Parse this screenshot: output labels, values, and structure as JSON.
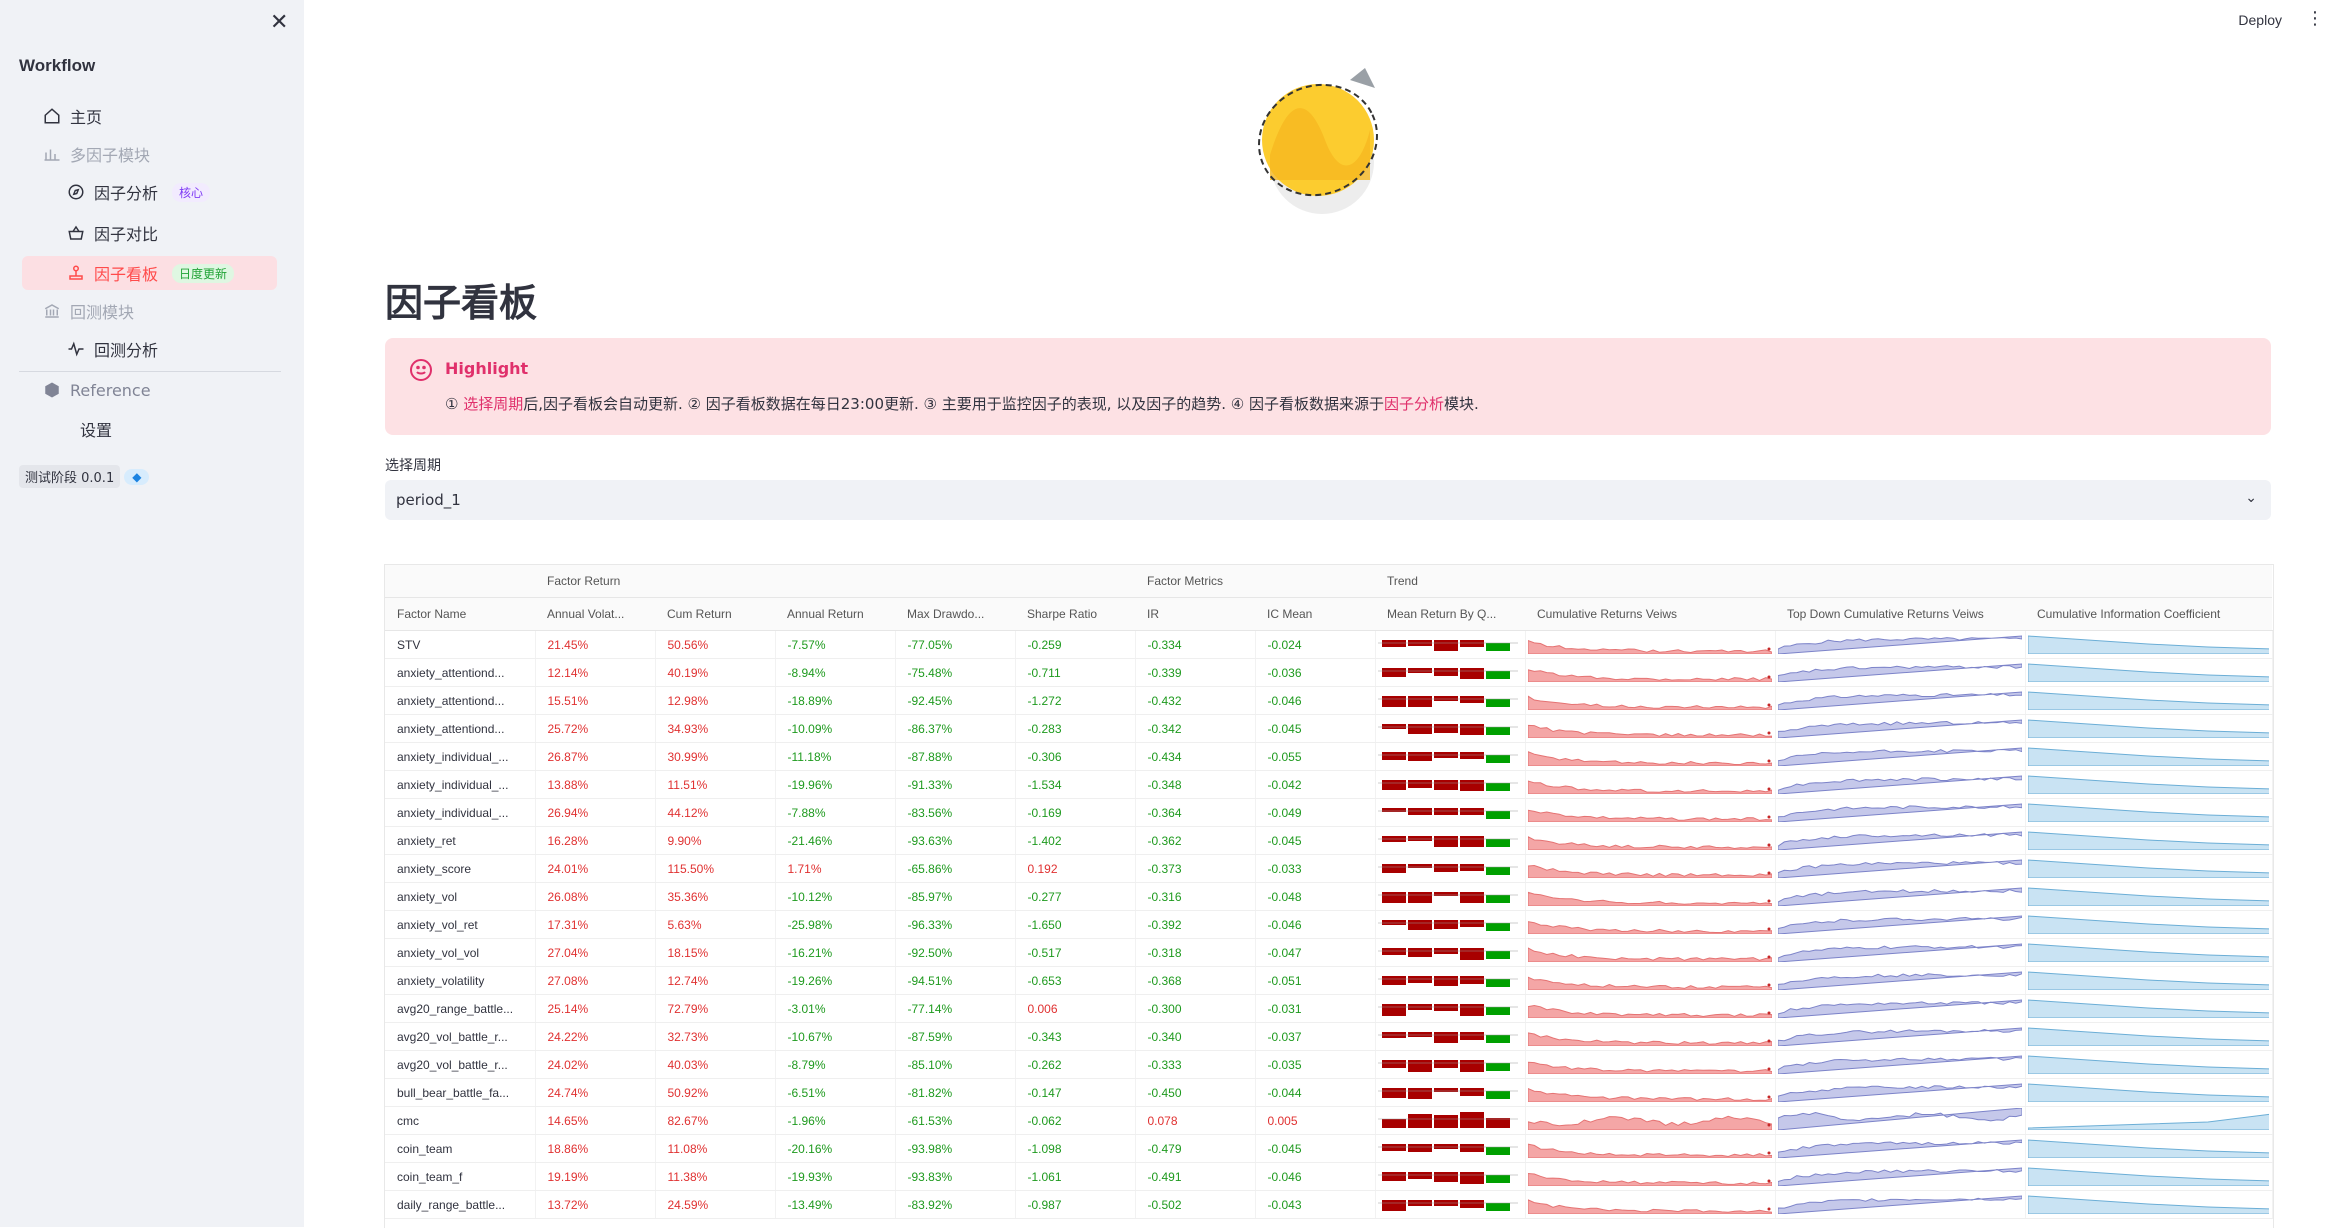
{
  "sidebar": {
    "close_icon": "close-icon",
    "title": "Workflow",
    "items": [
      {
        "label": "主页",
        "icon": "home-icon",
        "kind": "top"
      },
      {
        "label": "多因子模块",
        "icon": "bar-chart-icon",
        "kind": "section"
      },
      {
        "label": "因子分析",
        "icon": "compass-icon",
        "kind": "sub",
        "badge": "核心"
      },
      {
        "label": "因子对比",
        "icon": "basket-icon",
        "kind": "sub"
      },
      {
        "label": "因子看板",
        "icon": "joystick-icon",
        "kind": "sub-active",
        "badge": "日度更新"
      },
      {
        "label": "回测模块",
        "icon": "bank-icon",
        "kind": "section"
      },
      {
        "label": "回测分析",
        "icon": "activity-icon",
        "kind": "sub"
      },
      {
        "label": "Reference",
        "icon": "box-icon",
        "kind": "section"
      },
      {
        "label": "设置",
        "icon": "",
        "kind": "sub"
      }
    ],
    "version_label": "测试阶段 0.0.1",
    "version_icon": "cube-icon"
  },
  "header": {
    "deploy_label": "Deploy",
    "menu_icon": "more-vertical-icon"
  },
  "main": {
    "title": "因子看板",
    "alert": {
      "heading": "Highlight",
      "icon": "smile-icon",
      "p1": "① ",
      "link1": "选择周期",
      "p2": "后,因子看板会自动更新. ② 因子看板数据在每日23:00更新. ③ 主要用于监控因子的表现, 以及因子的趋势. ④ 因子看板数据来源于",
      "link2": "因子分析",
      "p3": "模块."
    },
    "select_label": "选择周期",
    "select_value": "period_1"
  },
  "table": {
    "groups": [
      "",
      "Factor Return",
      "",
      "",
      "",
      "",
      "Factor Metrics",
      "",
      "Trend",
      "",
      "",
      ""
    ],
    "headers": [
      "Factor Name",
      "Annual Volat...",
      "Cum Return",
      "Annual Return",
      "Max Drawdo...",
      "Sharpe Ratio",
      "IR",
      "IC Mean",
      "Mean Return By Q...",
      "Cumulative Returns Veiws",
      "Top Down Cumulative Returns Veiws",
      "Cumulative Information Coefficient"
    ],
    "rows": [
      [
        "STV",
        "21.45%",
        "50.56%",
        "-7.57%",
        "-77.05%",
        "-0.259",
        "-0.334",
        "-0.024"
      ],
      [
        "anxiety_attentiond...",
        "12.14%",
        "40.19%",
        "-8.94%",
        "-75.48%",
        "-0.711",
        "-0.339",
        "-0.036"
      ],
      [
        "anxiety_attentiond...",
        "15.51%",
        "12.98%",
        "-18.89%",
        "-92.45%",
        "-1.272",
        "-0.432",
        "-0.046"
      ],
      [
        "anxiety_attentiond...",
        "25.72%",
        "34.93%",
        "-10.09%",
        "-86.37%",
        "-0.283",
        "-0.342",
        "-0.045"
      ],
      [
        "anxiety_individual_...",
        "26.87%",
        "30.99%",
        "-11.18%",
        "-87.88%",
        "-0.306",
        "-0.434",
        "-0.055"
      ],
      [
        "anxiety_individual_...",
        "13.88%",
        "11.51%",
        "-19.96%",
        "-91.33%",
        "-1.534",
        "-0.348",
        "-0.042"
      ],
      [
        "anxiety_individual_...",
        "26.94%",
        "44.12%",
        "-7.88%",
        "-83.56%",
        "-0.169",
        "-0.364",
        "-0.049"
      ],
      [
        "anxiety_ret",
        "16.28%",
        "9.90%",
        "-21.46%",
        "-93.63%",
        "-1.402",
        "-0.362",
        "-0.045"
      ],
      [
        "anxiety_score",
        "24.01%",
        "115.50%",
        "1.71%",
        "-65.86%",
        "0.192",
        "-0.373",
        "-0.033"
      ],
      [
        "anxiety_vol",
        "26.08%",
        "35.36%",
        "-10.12%",
        "-85.97%",
        "-0.277",
        "-0.316",
        "-0.048"
      ],
      [
        "anxiety_vol_ret",
        "17.31%",
        "5.63%",
        "-25.98%",
        "-96.33%",
        "-1.650",
        "-0.392",
        "-0.046"
      ],
      [
        "anxiety_vol_vol",
        "27.04%",
        "18.15%",
        "-16.21%",
        "-92.50%",
        "-0.517",
        "-0.318",
        "-0.047"
      ],
      [
        "anxiety_volatility",
        "27.08%",
        "12.74%",
        "-19.26%",
        "-94.51%",
        "-0.653",
        "-0.368",
        "-0.051"
      ],
      [
        "avg20_range_battle...",
        "25.14%",
        "72.79%",
        "-3.01%",
        "-77.14%",
        "0.006",
        "-0.300",
        "-0.031"
      ],
      [
        "avg20_vol_battle_r...",
        "24.22%",
        "32.73%",
        "-10.67%",
        "-87.59%",
        "-0.343",
        "-0.340",
        "-0.037"
      ],
      [
        "avg20_vol_battle_r...",
        "24.02%",
        "40.03%",
        "-8.79%",
        "-85.10%",
        "-0.262",
        "-0.333",
        "-0.035"
      ],
      [
        "bull_bear_battle_fa...",
        "24.74%",
        "50.92%",
        "-6.51%",
        "-81.82%",
        "-0.147",
        "-0.450",
        "-0.044"
      ],
      [
        "cmc",
        "14.65%",
        "82.67%",
        "-1.96%",
        "-61.53%",
        "-0.062",
        "0.078",
        "0.005"
      ],
      [
        "coin_team",
        "18.86%",
        "11.08%",
        "-20.16%",
        "-93.98%",
        "-1.098",
        "-0.479",
        "-0.045"
      ],
      [
        "coin_team_f",
        "19.19%",
        "11.38%",
        "-19.93%",
        "-93.83%",
        "-1.061",
        "-0.491",
        "-0.046"
      ],
      [
        "daily_range_battle...",
        "13.72%",
        "24.59%",
        "-13.49%",
        "-83.92%",
        "-0.987",
        "-0.502",
        "-0.043"
      ]
    ],
    "colors": {
      "positive": "#e03131",
      "negative": "#1e9a1e",
      "bar_neg": "#a80000",
      "bar_pos": "#00a000",
      "area_red": "#f4a6a6",
      "area_blue": "#c5c8ea",
      "area_lightblue": "#c9e3f3"
    }
  }
}
